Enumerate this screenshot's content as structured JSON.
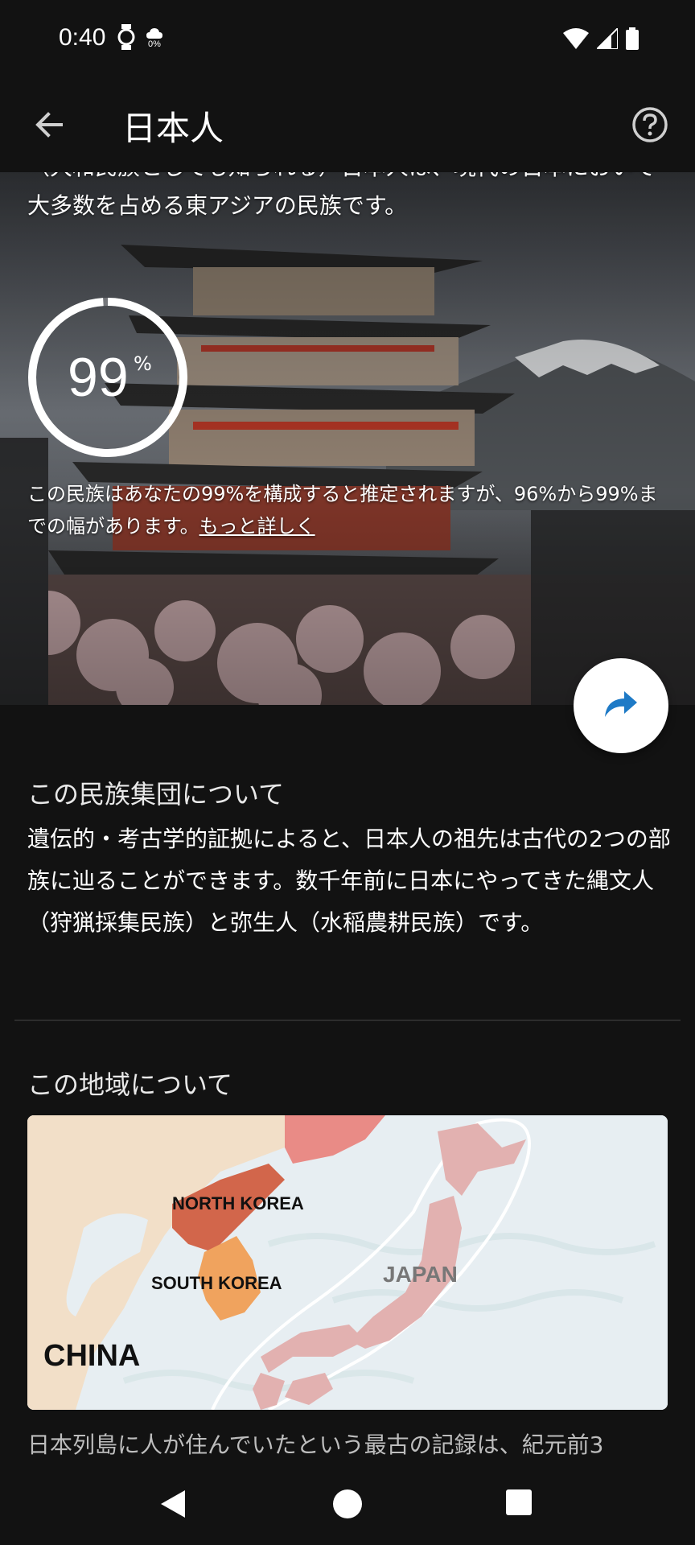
{
  "status_bar": {
    "time": "0:40",
    "icons_left": [
      "watch-icon",
      "weather-icon"
    ],
    "weather_percent": "0%",
    "icons_right": [
      "wifi-icon",
      "signal-icon",
      "battery-icon"
    ]
  },
  "app_bar": {
    "title": "日本人",
    "back_icon": "arrow-back-icon",
    "help_icon": "help-circle-icon"
  },
  "hero": {
    "intro_text": "（大和民族としても知られる）日本人は、現代の日本において大多数を占める東アジアの民族です。",
    "percent": "99",
    "percent_sign": "%",
    "percent_fraction": 0.99,
    "estimate_text": "この民族はあなたの99%を構成すると推定されますが、96%から99%までの幅があります。",
    "learn_more": "もっと詳しく"
  },
  "share_button": {
    "icon": "share-arrow-icon",
    "accent": "#1e7ac6"
  },
  "about_group": {
    "heading": "この民族集団について",
    "body": "遺伝的・考古学的証拠によると、日本人の祖先は古代の2つの部族に辿ることができます。数千年前に日本にやってきた縄文人（狩猟採集民族）と弥生人（水稲農耕民族）です。"
  },
  "region": {
    "heading": "この地域について",
    "map_labels": {
      "north_korea": "NORTH KOREA",
      "south_korea": "SOUTH KOREA",
      "japan": "JAPAN",
      "china": "CHINA"
    },
    "body": "日本列島に人が住んでいたという最古の記録は、紀元前3"
  },
  "nav_bar": {
    "icons": [
      "nav-back-icon",
      "nav-home-icon",
      "nav-recents-icon"
    ]
  },
  "colors": {
    "background": "#121212",
    "japan_fill": "#e2b1b0",
    "north_korea_fill": "#d2664b",
    "south_korea_fill": "#f0a35e",
    "russia_fill": "#e98b86",
    "china_fill": "#f2dfc8"
  }
}
